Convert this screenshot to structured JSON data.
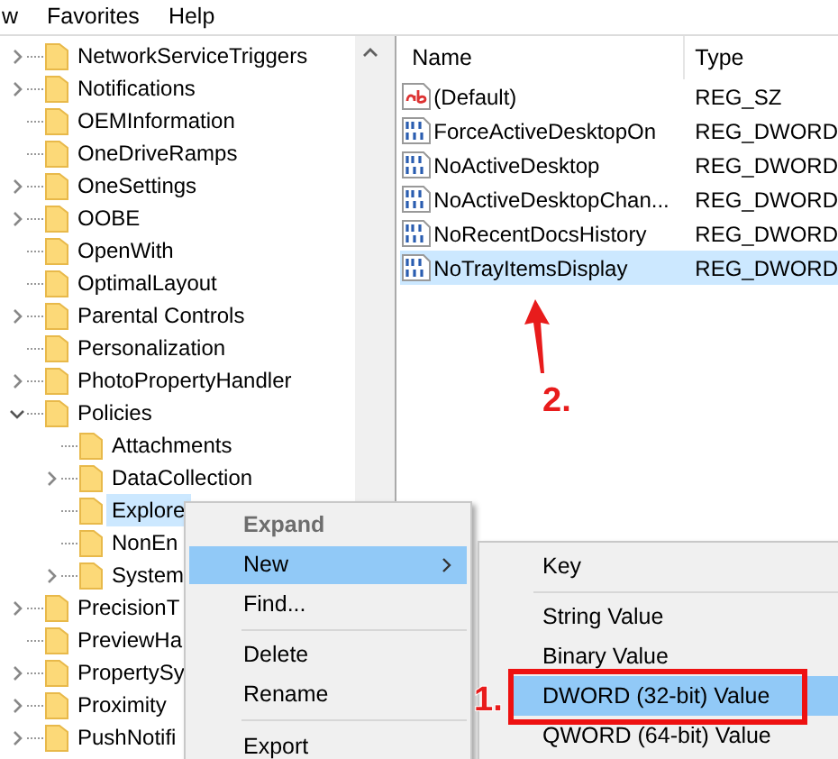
{
  "menu_bar": [
    "w",
    "Favorites",
    "Help"
  ],
  "tree": [
    {
      "label": "NetworkServiceTriggers",
      "expandable": true,
      "expanded": false,
      "selected": false
    },
    {
      "label": "Notifications",
      "expandable": true,
      "expanded": false,
      "selected": false
    },
    {
      "label": "OEMInformation",
      "expandable": false,
      "expanded": false,
      "selected": false
    },
    {
      "label": "OneDriveRamps",
      "expandable": false,
      "expanded": false,
      "selected": false
    },
    {
      "label": "OneSettings",
      "expandable": true,
      "expanded": false,
      "selected": false
    },
    {
      "label": "OOBE",
      "expandable": true,
      "expanded": false,
      "selected": false
    },
    {
      "label": "OpenWith",
      "expandable": false,
      "expanded": false,
      "selected": false
    },
    {
      "label": "OptimalLayout",
      "expandable": false,
      "expanded": false,
      "selected": false
    },
    {
      "label": "Parental Controls",
      "expandable": true,
      "expanded": false,
      "selected": false
    },
    {
      "label": "Personalization",
      "expandable": false,
      "expanded": false,
      "selected": false
    },
    {
      "label": "PhotoPropertyHandler",
      "expandable": true,
      "expanded": false,
      "selected": false
    },
    {
      "label": "Policies",
      "expandable": true,
      "expanded": true,
      "selected": false,
      "children": [
        {
          "label": "Attachments",
          "expandable": false,
          "expanded": false,
          "selected": false
        },
        {
          "label": "DataCollection",
          "expandable": true,
          "expanded": false,
          "selected": false
        },
        {
          "label": "Explore",
          "expandable": false,
          "expanded": false,
          "selected": true
        },
        {
          "label": "NonEn",
          "expandable": false,
          "expanded": false,
          "selected": false
        },
        {
          "label": "System",
          "expandable": true,
          "expanded": false,
          "selected": false
        }
      ]
    },
    {
      "label": "PrecisionT",
      "expandable": true,
      "expanded": false,
      "selected": false
    },
    {
      "label": "PreviewHa",
      "expandable": false,
      "expanded": false,
      "selected": false
    },
    {
      "label": "PropertySy",
      "expandable": true,
      "expanded": false,
      "selected": false
    },
    {
      "label": "Proximity",
      "expandable": true,
      "expanded": false,
      "selected": false
    },
    {
      "label": "PushNotifi",
      "expandable": true,
      "expanded": false,
      "selected": false
    }
  ],
  "list": {
    "columns": [
      "Name",
      "Type"
    ],
    "rows": [
      {
        "name": "(Default)",
        "type": "REG_SZ",
        "kind": "string",
        "selected": false
      },
      {
        "name": "ForceActiveDesktopOn",
        "type": "REG_DWORD",
        "kind": "binary",
        "selected": false
      },
      {
        "name": "NoActiveDesktop",
        "type": "REG_DWORD",
        "kind": "binary",
        "selected": false
      },
      {
        "name": "NoActiveDesktopChan...",
        "type": "REG_DWORD",
        "kind": "binary",
        "selected": false
      },
      {
        "name": "NoRecentDocsHistory",
        "type": "REG_DWORD",
        "kind": "binary",
        "selected": false
      },
      {
        "name": "NoTrayItemsDisplay",
        "type": "REG_DWORD",
        "kind": "binary",
        "selected": true
      }
    ]
  },
  "context_menu": {
    "items": [
      {
        "kind": "item",
        "label": "Expand",
        "default": true,
        "disabled": true,
        "selected": false,
        "has_submenu": false
      },
      {
        "kind": "item",
        "label": "New",
        "default": false,
        "disabled": false,
        "selected": true,
        "has_submenu": true
      },
      {
        "kind": "item",
        "label": "Find...",
        "default": false,
        "disabled": false,
        "selected": false,
        "has_submenu": false
      },
      {
        "kind": "separator"
      },
      {
        "kind": "item",
        "label": "Delete",
        "default": false,
        "disabled": false,
        "selected": false,
        "has_submenu": false
      },
      {
        "kind": "item",
        "label": "Rename",
        "default": false,
        "disabled": false,
        "selected": false,
        "has_submenu": false
      },
      {
        "kind": "separator"
      },
      {
        "kind": "item",
        "label": "Export",
        "default": false,
        "disabled": false,
        "selected": false,
        "has_submenu": false
      }
    ]
  },
  "submenu": {
    "items": [
      {
        "kind": "item",
        "label": "Key",
        "selected": false,
        "highlighted": false
      },
      {
        "kind": "separator"
      },
      {
        "kind": "item",
        "label": "String Value",
        "selected": false,
        "highlighted": false
      },
      {
        "kind": "item",
        "label": "Binary Value",
        "selected": false,
        "highlighted": false
      },
      {
        "kind": "item",
        "label": "DWORD (32-bit) Value",
        "selected": true,
        "highlighted": true
      },
      {
        "kind": "item",
        "label": "QWORD (64-bit) Value",
        "selected": false,
        "highlighted": false
      }
    ]
  },
  "annotations": [
    {
      "label": "1."
    },
    {
      "label": "2."
    }
  ]
}
